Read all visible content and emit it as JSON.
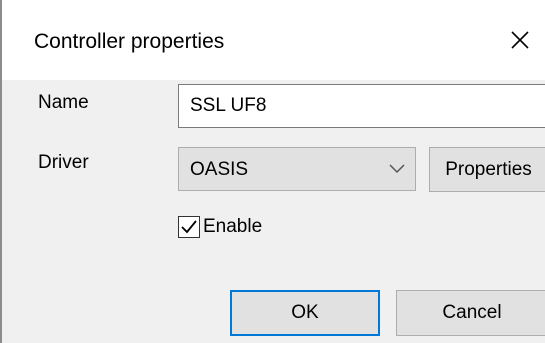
{
  "dialog": {
    "title": "Controller properties",
    "close_icon": "close-icon"
  },
  "form": {
    "name_label": "Name",
    "name_value": "SSL UF8",
    "driver_label": "Driver",
    "driver_value": "OASIS",
    "driver_dropdown_icon": "chevron-down-icon",
    "properties_label": "Properties",
    "enable_label": "Enable",
    "enable_checked": true
  },
  "footer": {
    "ok_label": "OK",
    "cancel_label": "Cancel"
  },
  "colors": {
    "dialog_background": "#f0f0f0",
    "titlebar_background": "#ffffff",
    "button_background": "#e1e1e1",
    "focus_accent": "#0078d7"
  }
}
